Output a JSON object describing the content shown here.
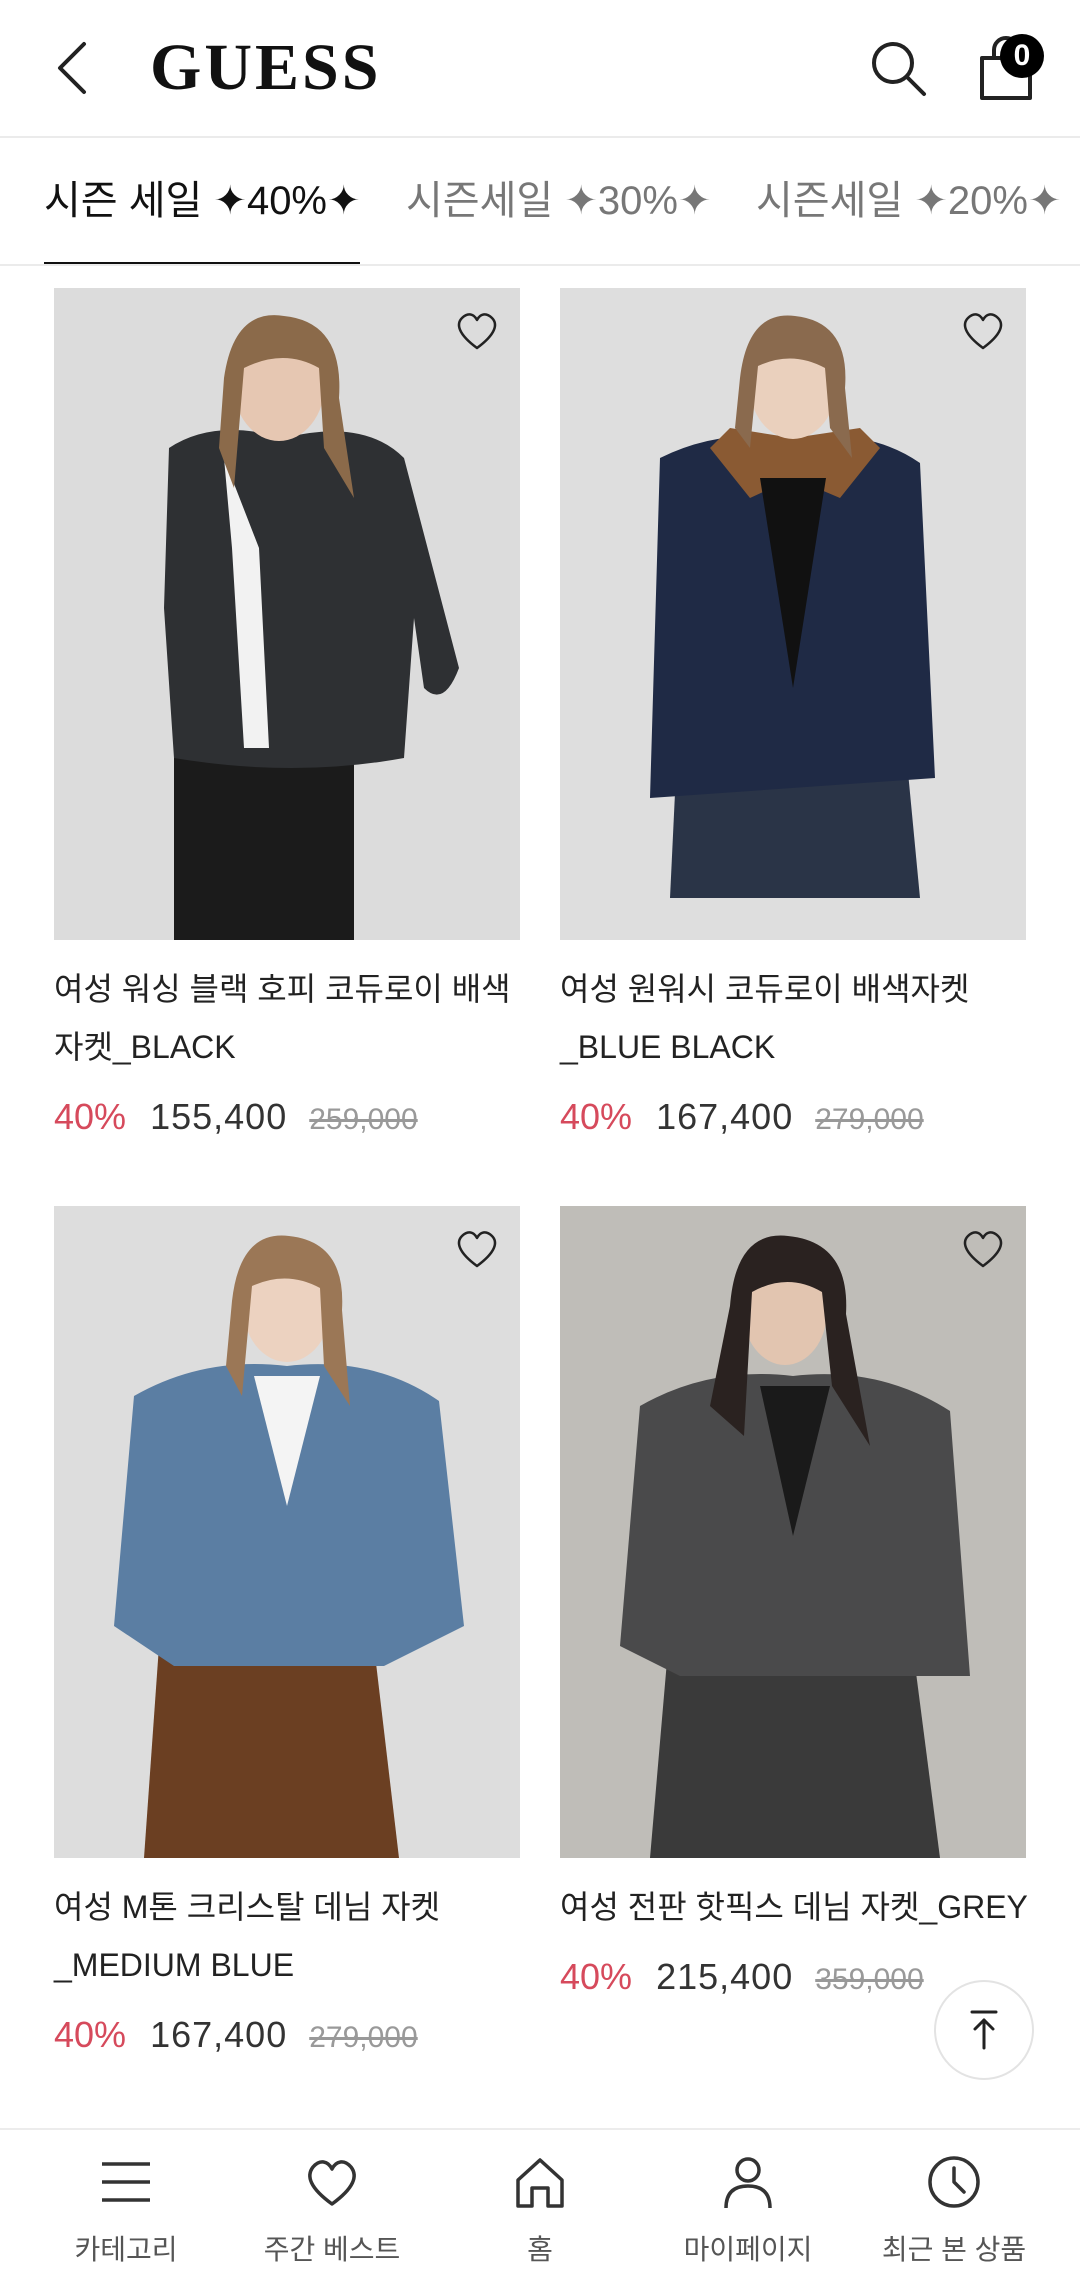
{
  "header": {
    "logo": "GUESS",
    "cart_count": "0"
  },
  "tabs": [
    {
      "label": "시즌 세일 ✦40%✦",
      "active": true
    },
    {
      "label": "시즌세일 ✦30%✦",
      "active": false
    },
    {
      "label": "시즌세일 ✦20%✦",
      "active": false
    }
  ],
  "products": [
    {
      "name": "여성 워싱 블랙 호피 코듀로이 배색 자켓_BLACK",
      "discount": "40%",
      "price": "155,400",
      "original_price": "259,000"
    },
    {
      "name": "여성 원워시 코듀로이 배색자켓 _BLUE BLACK",
      "discount": "40%",
      "price": "167,400",
      "original_price": "279,000"
    },
    {
      "name": "여성 M톤 크리스탈 데님 자켓 _MEDIUM BLUE",
      "discount": "40%",
      "price": "167,400",
      "original_price": "279,000"
    },
    {
      "name": "여성 전판 핫픽스 데님 자켓_GREY",
      "discount": "40%",
      "price": "215,400",
      "original_price": "359,000"
    }
  ],
  "bottom_nav": [
    {
      "label": "카테고리",
      "icon": "menu-icon"
    },
    {
      "label": "주간 베스트",
      "icon": "heart-icon"
    },
    {
      "label": "홈",
      "icon": "home-icon"
    },
    {
      "label": "마이페이지",
      "icon": "user-icon"
    },
    {
      "label": "최근 본 상품",
      "icon": "clock-icon"
    }
  ],
  "colors": {
    "discount": "#d64a5c",
    "text": "#1a1a1a",
    "muted": "#999999"
  }
}
